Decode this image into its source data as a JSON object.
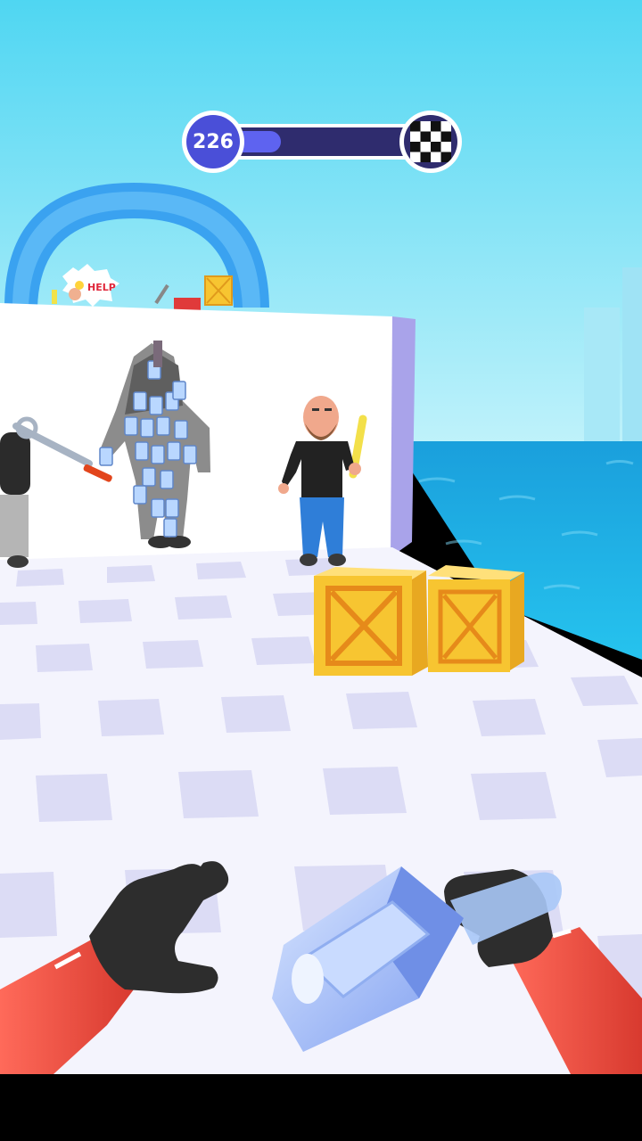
{
  "hud": {
    "level": "226",
    "progress": 0.32,
    "finish_icon": "checkered-flag-icon"
  },
  "scene": {
    "help_bubble": "HELP",
    "colors": {
      "sky_top": "#4fd6f2",
      "sky_bottom": "#bff1fb",
      "water": "#1eb8ea",
      "tile_light": "#ffffff",
      "tile_dark": "#dcdcf5",
      "crate": "#f7c531",
      "glove": "#2d2d2d",
      "sleeve": "#e8493d"
    }
  }
}
